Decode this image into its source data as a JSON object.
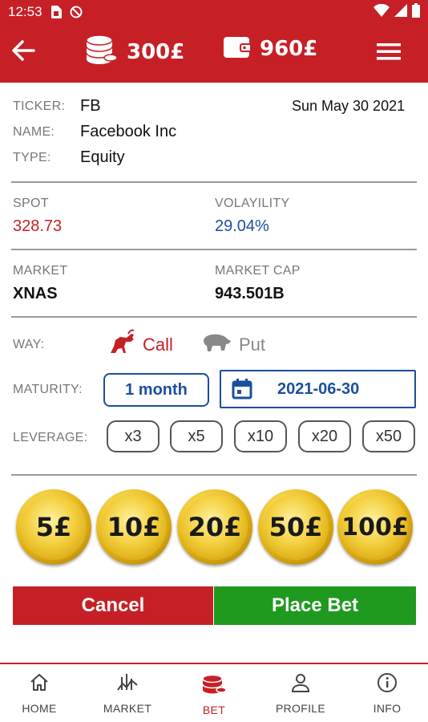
{
  "status_bar": {
    "time": "12:53"
  },
  "header": {
    "coins_amount": "300£",
    "wallet_amount": "960£"
  },
  "info": {
    "ticker_label": "TICKER:",
    "ticker": "FB",
    "name_label": "NAME:",
    "name": "Facebook Inc",
    "type_label": "TYPE:",
    "type": "Equity",
    "date": "Sun May 30 2021"
  },
  "stats": {
    "spot_label": "SPOT",
    "spot": "328.73",
    "vol_label": "VOLAYILITY",
    "vol": "29.04%",
    "market_label": "MARKET",
    "market": "XNAS",
    "cap_label": "MARKET CAP",
    "cap": "943.501B"
  },
  "bet": {
    "way_label": "WAY:",
    "call_label": "Call",
    "put_label": "Put",
    "maturity_label": "MATURITY:",
    "maturity": "1 month",
    "maturity_date": "2021-06-30",
    "leverage_label": "LEVERAGE:",
    "leverages": [
      "x3",
      "x5",
      "x10",
      "x20",
      "x50"
    ],
    "amounts": [
      "5£",
      "10£",
      "20£",
      "50£",
      "100£"
    ]
  },
  "actions": {
    "cancel": "Cancel",
    "place": "Place Bet"
  },
  "nav": [
    "HOME",
    "MARKET",
    "BET",
    "PROFILE",
    "INFO"
  ],
  "colors": {
    "brand": "#c62026",
    "accent_blue": "#1a4f9c",
    "confirm": "#1f9a1f"
  }
}
